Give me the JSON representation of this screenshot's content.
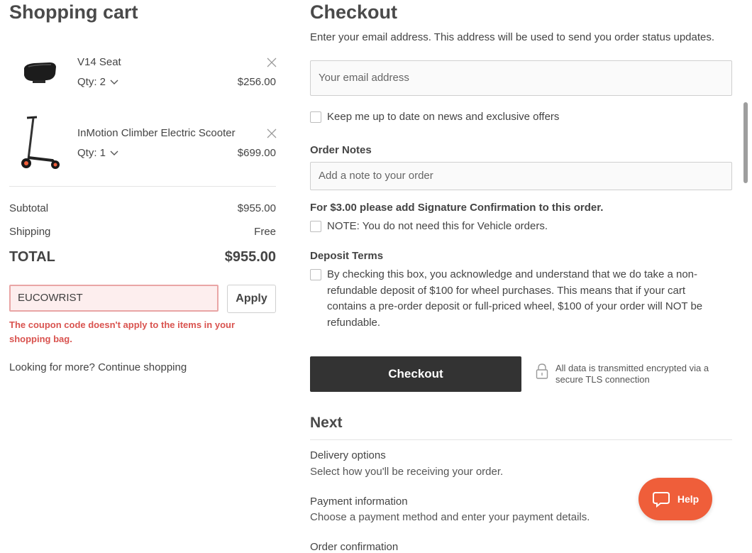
{
  "cart": {
    "title": "Shopping cart",
    "items": [
      {
        "name": "V14 Seat",
        "qty_label": "Qty: 2",
        "price": "$256.00"
      },
      {
        "name": "InMotion Climber Electric Scooter",
        "qty_label": "Qty: 1",
        "price": "$699.00"
      }
    ],
    "subtotal_label": "Subtotal",
    "subtotal_value": "$955.00",
    "shipping_label": "Shipping",
    "shipping_value": "Free",
    "total_label": "TOTAL",
    "total_value": "$955.00",
    "coupon_value": "EUCOWRIST",
    "apply_label": "Apply",
    "coupon_error": "The coupon code doesn't apply to the items in your shopping bag.",
    "continue_prefix": "Looking for more?",
    "continue_link": "Continue shopping"
  },
  "checkout": {
    "title": "Checkout",
    "intro": "Enter your email address. This address will be used to send you order status updates.",
    "email_placeholder": "Your email address",
    "newsletter_label": "Keep me up to date on news and exclusive offers",
    "order_notes_label": "Order Notes",
    "order_notes_placeholder": "Add a note to your order",
    "signature_label": "For $3.00 please add Signature Confirmation to this order.",
    "signature_note": "NOTE: You do not need this for Vehicle orders.",
    "deposit_label": "Deposit Terms",
    "deposit_text": "By checking this box, you acknowledge and understand that we do take a non-refundable deposit of $100 for wheel purchases. This means that if your cart contains a pre-order deposit or full-priced wheel, $100 of your order will NOT be refundable.",
    "checkout_button": "Checkout",
    "secure_text": "All data is transmitted encrypted via a secure TLS connection"
  },
  "next": {
    "title": "Next",
    "steps": [
      {
        "title": "Delivery options",
        "desc": "Select how you'll be receiving your order."
      },
      {
        "title": "Payment information",
        "desc": "Choose a payment method and enter your payment details."
      },
      {
        "title": "Order confirmation",
        "desc": ""
      }
    ]
  },
  "help": {
    "label": "Help"
  },
  "icons": {
    "remove": "close-icon",
    "qty": "chevron-down-icon",
    "secure": "lock-icon",
    "help": "chat-bubble-icon"
  },
  "colors": {
    "button_dark": "#333333",
    "error": "#d9534f",
    "help_button": "#ef5e3a"
  }
}
